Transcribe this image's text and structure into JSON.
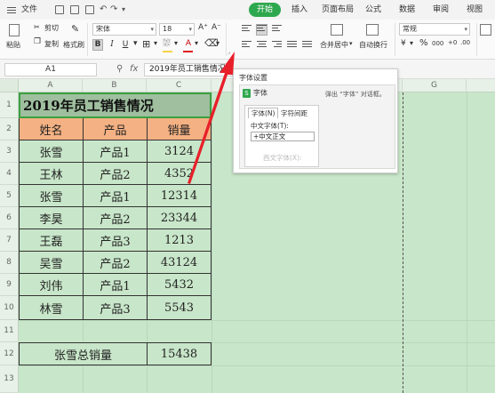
{
  "menubar": {
    "file": "文件",
    "tabs": [
      "开始",
      "插入",
      "页面布局",
      "公式",
      "数据",
      "审阅",
      "视图"
    ],
    "active_tab": "开始",
    "accent": "#2ea84e"
  },
  "ribbon": {
    "paste": "粘贴",
    "cut": "剪切",
    "copy": "复制",
    "format_painter": "格式刷",
    "font_name": "宋体",
    "font_size": "18",
    "bold": "B",
    "italic": "I",
    "underline": "U",
    "font_color_letter": "A",
    "merge_center": "合并居中",
    "auto_wrap": "自动换行",
    "number_format": "常规",
    "percent": "%",
    "thousands": "000"
  },
  "formula_bar": {
    "cell_ref": "A1",
    "fx": "fx",
    "content": "2019年员工销售情况"
  },
  "sheet": {
    "columns": [
      "A",
      "B",
      "C",
      "G"
    ],
    "rows": [
      "1",
      "2",
      "3",
      "4",
      "5",
      "6",
      "7",
      "8",
      "9",
      "10",
      "11",
      "12",
      "13"
    ],
    "title": "2019年员工销售情况",
    "headers": [
      "姓名",
      "产品",
      "销量"
    ],
    "data": [
      [
        "张雪",
        "产品1",
        "3124"
      ],
      [
        "王林",
        "产品2",
        "4352"
      ],
      [
        "张雪",
        "产品1",
        "12314"
      ],
      [
        "李昊",
        "产品2",
        "23344"
      ],
      [
        "王磊",
        "产品3",
        "1213"
      ],
      [
        "吴雪",
        "产品2",
        "43124"
      ],
      [
        "刘伟",
        "产品1",
        "5432"
      ],
      [
        "林雪",
        "产品3",
        "5543"
      ]
    ],
    "summary_label": "张雪总销量",
    "summary_value": "15438",
    "header_fill": "#f4b183",
    "sheet_fill": "#c8e6c9"
  },
  "dialog": {
    "title": "字体设置",
    "heading": "字体",
    "description": "弹出 “字体” 对话框。",
    "tabs": [
      "字体(N)",
      "字符间距"
    ],
    "field_label": "中文字体(T):",
    "field_value": "+中文正文",
    "faded_label": "西文字体(X):"
  }
}
